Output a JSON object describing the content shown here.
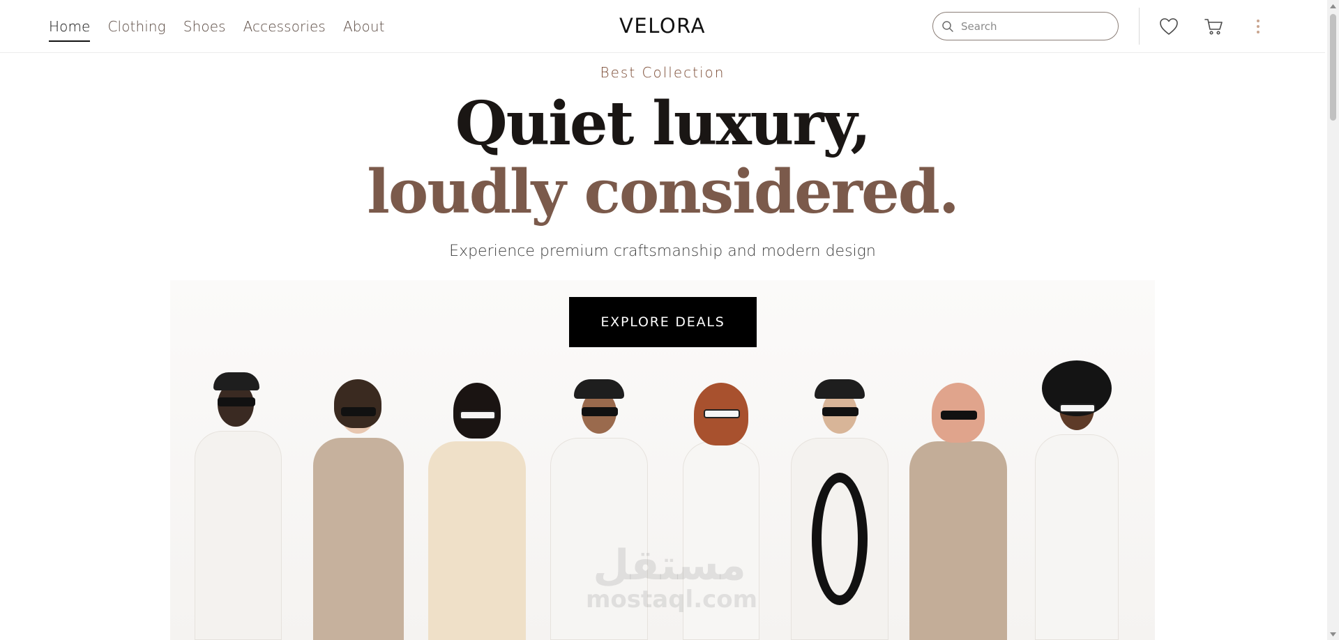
{
  "header": {
    "nav": [
      {
        "label": "Home",
        "active": true
      },
      {
        "label": "Clothing",
        "active": false
      },
      {
        "label": "Shoes",
        "active": false
      },
      {
        "label": "Accessories",
        "active": false
      },
      {
        "label": "About",
        "active": false
      }
    ],
    "logo": "VELORA",
    "search": {
      "placeholder": "Search",
      "value": "",
      "icon": "search-icon"
    },
    "icons": [
      "heart-icon",
      "cart-icon",
      "more-vertical-icon"
    ]
  },
  "hero": {
    "eyebrow": "Best Collection",
    "headline_line1": "Quiet luxury,",
    "headline_line2": "loudly considered.",
    "subheadline": "Experience premium craftsmanship and modern design",
    "cta_label": "EXPLORE DEALS",
    "image_description_watermark": {
      "line1": "مستقل",
      "line2": "mostaql.com"
    }
  },
  "colors": {
    "accent_brown": "#7b5a4b",
    "eyebrow_brown": "#7a4a33",
    "cta_bg": "#000000",
    "kebab_dots": "#c9a58f"
  }
}
